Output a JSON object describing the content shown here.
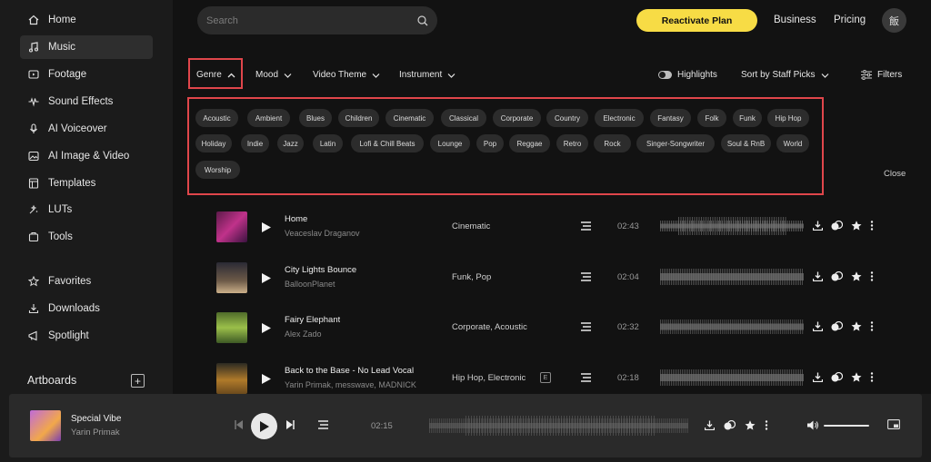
{
  "sidebar": {
    "items": [
      {
        "label": "Home",
        "icon": "home-icon"
      },
      {
        "label": "Music",
        "icon": "music-note-icon",
        "active": true
      },
      {
        "label": "Footage",
        "icon": "video-icon"
      },
      {
        "label": "Sound Effects",
        "icon": "waveform-icon"
      },
      {
        "label": "AI Voiceover",
        "icon": "microphone-icon"
      },
      {
        "label": "AI Image & Video",
        "icon": "ai-image-icon"
      },
      {
        "label": "Templates",
        "icon": "templates-icon"
      },
      {
        "label": "LUTs",
        "icon": "luts-icon"
      },
      {
        "label": "Tools",
        "icon": "tools-icon"
      },
      {
        "label": "Favorites",
        "icon": "star-outline-icon"
      },
      {
        "label": "Downloads",
        "icon": "download-icon"
      },
      {
        "label": "Spotlight",
        "icon": "spotlight-icon"
      }
    ],
    "artboards_label": "Artboards",
    "artboards_add": "+"
  },
  "header": {
    "search_placeholder": "Search",
    "reactivate_label": "Reactivate Plan",
    "business_label": "Business",
    "pricing_label": "Pricing",
    "avatar_text": "飯"
  },
  "filters": {
    "genre": "Genre",
    "mood": "Mood",
    "video_theme": "Video Theme",
    "instrument": "Instrument",
    "highlights": "Highlights",
    "sort": "Sort by Staff Picks",
    "filters": "Filters",
    "close": "Close"
  },
  "genres": [
    "Acoustic",
    "Ambient",
    "Blues",
    "Children",
    "Cinematic",
    "Classical",
    "Corporate",
    "Country",
    "Electronic",
    "Fantasy",
    "Folk",
    "Funk",
    "Hip Hop",
    "Holiday",
    "Indie",
    "Jazz",
    "Latin",
    "Lofi & Chill Beats",
    "Lounge",
    "Pop",
    "Reggae",
    "Retro",
    "Rock",
    "Singer-Songwriter",
    "Soul & RnB",
    "World",
    "Worship"
  ],
  "tracks": [
    {
      "title": "Home",
      "artist": "Veaceslav Draganov",
      "genre": "Cinematic",
      "duration": "02:43"
    },
    {
      "title": "City Lights Bounce",
      "artist": "BalloonPlanet",
      "genre": "Funk, Pop",
      "duration": "02:04"
    },
    {
      "title": "Fairy Elephant",
      "artist": "Alex Zado",
      "genre": "Corporate, Acoustic",
      "duration": "02:32"
    },
    {
      "title": "Back to the Base - No Lead Vocal",
      "artist": "Yarin Primak, messwave, MADNICK",
      "genre": "Hip Hop, Electronic",
      "badge": "E",
      "duration": "02:18"
    }
  ],
  "player": {
    "title": "Special Vibe",
    "artist": "Yarin Primak",
    "time": "02:15"
  },
  "colors": {
    "accent_yellow": "#f7dc45",
    "highlight_red": "#e0464b"
  }
}
